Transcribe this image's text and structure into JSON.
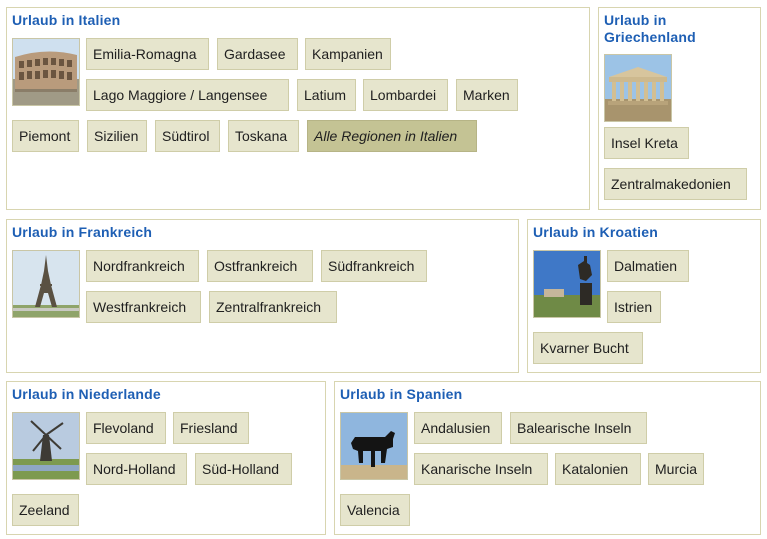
{
  "italy": {
    "title": "Urlaub in Italien",
    "image": "colosseum-photo",
    "regions": [
      "Emilia-Romagna",
      "Gardasee",
      "Kampanien",
      "Lago Maggiore / Langensee",
      "Latium",
      "Lombardei",
      "Marken",
      "Piemont",
      "Sizilien",
      "Südtirol",
      "Toskana"
    ],
    "all": "Alle Regionen in Italien"
  },
  "greece": {
    "title_line1": "Urlaub in",
    "title_line2": "Griechenland",
    "image": "parthenon-photo",
    "regions": [
      "Insel Kreta",
      "Zentralmakedonien"
    ]
  },
  "france": {
    "title": "Urlaub in Frankreich",
    "image": "eiffel-tower-photo",
    "regions": [
      "Nordfrankreich",
      "Ostfrankreich",
      "Südfrankreich",
      "Westfrankreich",
      "Zentralfrankreich"
    ]
  },
  "croatia": {
    "title": "Urlaub in Kroatien",
    "image": "equestrian-statue-photo",
    "regions": [
      "Dalmatien",
      "Istrien",
      "Kvarner Bucht"
    ]
  },
  "netherlands": {
    "title": "Urlaub in Niederlande",
    "image": "windmill-photo",
    "regions": [
      "Flevoland",
      "Friesland",
      "Nord-Holland",
      "Süd-Holland",
      "Zeeland"
    ]
  },
  "spain": {
    "title": "Urlaub in Spanien",
    "image": "osborne-bull-photo",
    "regions": [
      "Andalusien",
      "Balearische Inseln",
      "Kanarische Inseln",
      "Katalonien",
      "Murcia",
      "Valencia"
    ]
  },
  "colors": {
    "heading": "#1e5fb4",
    "chip": "#e6e5cd",
    "chip_all": "#c4c394",
    "border": "#d8d5b0"
  }
}
